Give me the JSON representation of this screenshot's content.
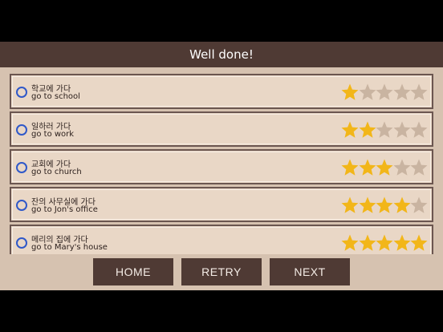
{
  "header": {
    "title": "Well done!"
  },
  "colors": {
    "star_filled": "#f2b619",
    "star_empty": "#c9b4a1",
    "radio": "#2f58c9"
  },
  "items": [
    {
      "korean": "학교에 가다",
      "english": "go to school",
      "rating": 1,
      "max": 5
    },
    {
      "korean": "일하러 가다",
      "english": "go to work",
      "rating": 2,
      "max": 5
    },
    {
      "korean": "교회에 가다",
      "english": "go to church",
      "rating": 3,
      "max": 5
    },
    {
      "korean": "잔의 사무실에 가다",
      "english": "go to Jon's office",
      "rating": 4,
      "max": 5
    },
    {
      "korean": "메리의 집에 가다",
      "english": "go to Mary's house",
      "rating": 5,
      "max": 5
    }
  ],
  "buttons": {
    "home": "HOME",
    "retry": "RETRY",
    "next": "NEXT"
  }
}
